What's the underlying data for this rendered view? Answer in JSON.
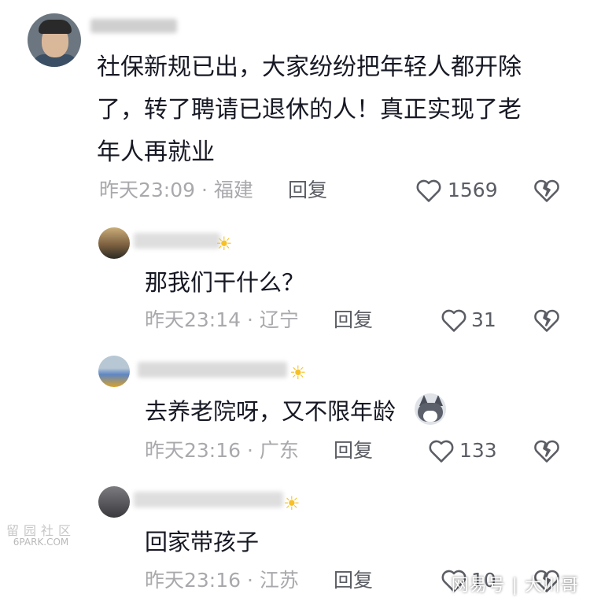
{
  "comments": [
    {
      "text_lines": [
        "社保新规已出，大家纷纷把年轻人都开除",
        "了，转了聘请已退休的人！真正实现了老",
        "年人再就业"
      ],
      "time": "昨天23:09",
      "location": "福建",
      "reply_label": "回复",
      "likes": "1569"
    },
    {
      "text": "那我们干什么？",
      "time": "昨天23:14",
      "location": "辽宁",
      "reply_label": "回复",
      "likes": "31"
    },
    {
      "text": "去养老院呀，又不限年龄",
      "time": "昨天23:16",
      "location": "广东",
      "reply_label": "回复",
      "likes": "133"
    },
    {
      "text": "回家带孩子",
      "time": "昨天23:16",
      "location": "江苏",
      "reply_label": "回复",
      "likes": "10"
    }
  ],
  "separator": "·",
  "watermarks": {
    "left_cn": "留园社区",
    "left_en": "6PARK.COM",
    "right": "网易号 | 大川哥"
  },
  "colors": {
    "text": "#161823",
    "meta": "#a9a9ad",
    "reply": "#5b5d64",
    "sun_emoji": "#f6c026"
  },
  "icons": [
    "heart-outline-icon",
    "broken-heart-icon",
    "sun-emoji-icon",
    "husky-dog-emoji-icon"
  ]
}
